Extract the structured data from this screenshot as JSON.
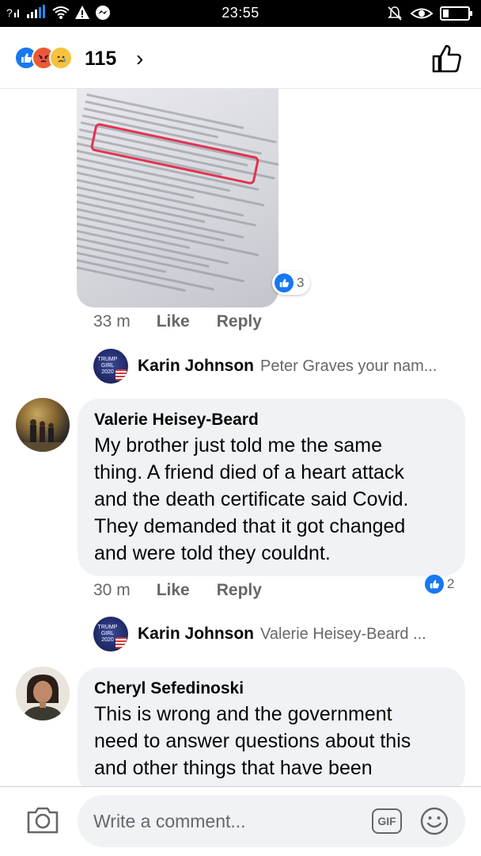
{
  "status_bar": {
    "time": "23:55",
    "left_icons": [
      "sim-icon",
      "signal-icon",
      "wifi-icon",
      "alert-icon",
      "messenger-icon"
    ],
    "right_icons": [
      "mute-icon",
      "eye-icon",
      "battery-icon"
    ]
  },
  "reactions": {
    "icons": [
      "like",
      "angry",
      "sad"
    ],
    "count": "115",
    "chevron": "›"
  },
  "image_comment": {
    "reaction_count": "3",
    "time": "33 m",
    "like_label": "Like",
    "reply_label": "Reply"
  },
  "reply_preview_1": {
    "avatar_text": "TRUMP GIRL 2020",
    "name": "Karin Johnson",
    "snippet": "Peter Graves  your nam..."
  },
  "comment_valerie": {
    "author": "Valerie Heisey-Beard",
    "lines": [
      "My brother just told me the same",
      "thing. A friend died of a heart attack",
      "and the death certificate said Covid.",
      "They demanded that it got changed",
      "and were told they couldnt."
    ],
    "reaction_count": "2",
    "time": "30 m",
    "like_label": "Like",
    "reply_label": "Reply"
  },
  "reply_preview_2": {
    "avatar_text": "TRUMP GIRL 2020",
    "name": "Karin Johnson",
    "snippet": "Valerie Heisey-Beard ..."
  },
  "comment_cheryl": {
    "author": "Cheryl Sefedinoski",
    "lines": [
      "This is wrong and the government",
      "need to answer questions about this",
      "and other things that have been"
    ]
  },
  "composer": {
    "placeholder": "Write a comment...",
    "gif_label": "GIF"
  },
  "colors": {
    "like_blue": "#1877f2",
    "bubble_gray": "#f0f2f5",
    "secondary_text": "#65676b",
    "highlight_red": "#e2334f"
  }
}
